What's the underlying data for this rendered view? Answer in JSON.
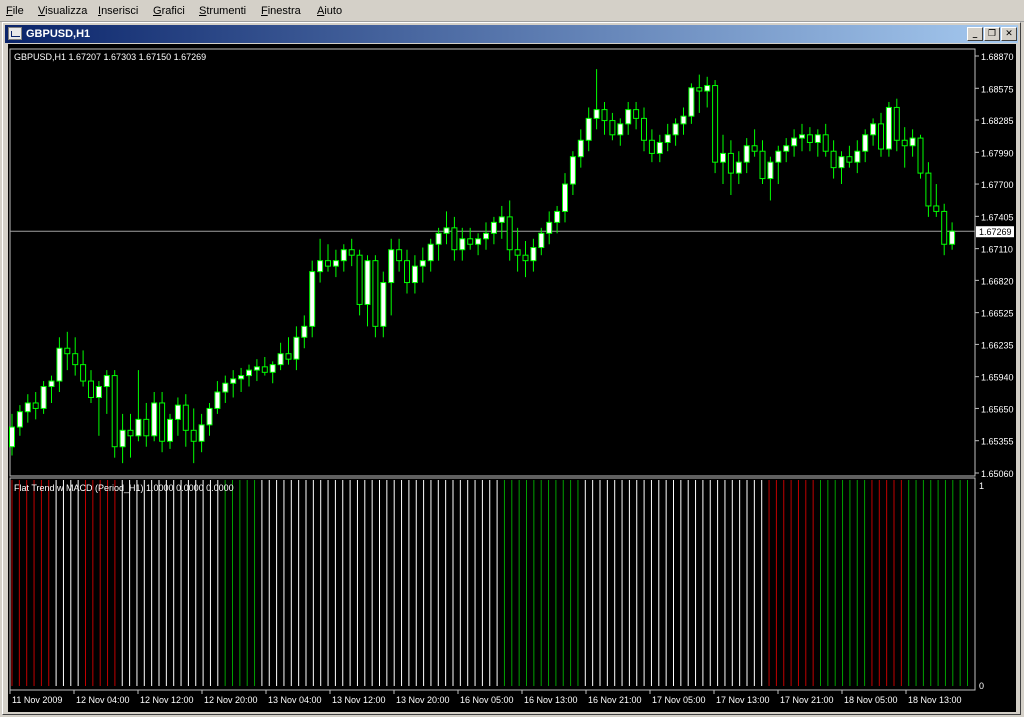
{
  "menu": [
    {
      "label": "File",
      "underline": "F",
      "rest": "ile"
    },
    {
      "label": "Visualizza",
      "underline": "V",
      "rest": "isualizza"
    },
    {
      "label": "Inserisci",
      "underline": "I",
      "rest": "nserisci"
    },
    {
      "label": "Grafici",
      "underline": "G",
      "rest": "rafici"
    },
    {
      "label": "Strumenti",
      "underline": "S",
      "rest": "trumenti"
    },
    {
      "label": "Finestra",
      "underline": "F",
      "rest": "inestra"
    },
    {
      "label": "Aiuto",
      "underline": "A",
      "rest": "iuto"
    }
  ],
  "window": {
    "title": "GBPUSD,H1",
    "buttons": {
      "minimize": "_",
      "restore": "❐",
      "close": "✕"
    }
  },
  "colors": {
    "background": "#000000",
    "bull_fill": "#ffffff",
    "candle_outline": "#00ff00",
    "axis": "#c0c0c0",
    "text": "#ffffff",
    "hist_red": "#c00000",
    "hist_green": "#00a000",
    "hist_white": "#ffffff",
    "current_price_line": "#a0a0a0"
  },
  "chart_data": [
    {
      "type": "candlestick",
      "symbol_info": "GBPUSD,H1  1.67207 1.67303 1.67150 1.67269",
      "current_price": 1.67269,
      "current_price_label": "1.67269",
      "ylim": [
        1.6506,
        1.6887
      ],
      "yticks": [
        "1.68870",
        "1.68575",
        "1.68285",
        "1.67990",
        "1.67700",
        "1.67405",
        "1.67110",
        "1.66820",
        "1.66525",
        "1.66235",
        "1.65940",
        "1.65650",
        "1.65355",
        "1.65060"
      ],
      "ytick_values": [
        1.6887,
        1.68575,
        1.68285,
        1.6799,
        1.677,
        1.67405,
        1.6711,
        1.6682,
        1.66525,
        1.66235,
        1.6594,
        1.6565,
        1.65355,
        1.6506
      ],
      "candles": [
        [
          1.653,
          1.656,
          1.6522,
          1.6548
        ],
        [
          1.6548,
          1.6568,
          1.654,
          1.6562
        ],
        [
          1.6562,
          1.6578,
          1.6552,
          1.657
        ],
        [
          1.657,
          1.658,
          1.6555,
          1.6565
        ],
        [
          1.6565,
          1.659,
          1.656,
          1.6585
        ],
        [
          1.6585,
          1.6595,
          1.657,
          1.659
        ],
        [
          1.659,
          1.663,
          1.658,
          1.662
        ],
        [
          1.662,
          1.6635,
          1.66,
          1.6615
        ],
        [
          1.6615,
          1.663,
          1.6595,
          1.6605
        ],
        [
          1.6605,
          1.6618,
          1.6585,
          1.659
        ],
        [
          1.659,
          1.66,
          1.657,
          1.6575
        ],
        [
          1.6575,
          1.659,
          1.654,
          1.6585
        ],
        [
          1.6585,
          1.66,
          1.656,
          1.6595
        ],
        [
          1.6595,
          1.66,
          1.652,
          1.653
        ],
        [
          1.653,
          1.656,
          1.6515,
          1.6545
        ],
        [
          1.6545,
          1.656,
          1.652,
          1.654
        ],
        [
          1.654,
          1.66,
          1.6535,
          1.6555
        ],
        [
          1.6555,
          1.657,
          1.653,
          1.654
        ],
        [
          1.654,
          1.658,
          1.6535,
          1.657
        ],
        [
          1.657,
          1.658,
          1.6525,
          1.6535
        ],
        [
          1.6535,
          1.656,
          1.6528,
          1.6555
        ],
        [
          1.6555,
          1.6575,
          1.654,
          1.6568
        ],
        [
          1.6568,
          1.6578,
          1.653,
          1.6545
        ],
        [
          1.6545,
          1.6565,
          1.6515,
          1.6535
        ],
        [
          1.6535,
          1.656,
          1.6525,
          1.655
        ],
        [
          1.655,
          1.657,
          1.654,
          1.6565
        ],
        [
          1.6565,
          1.659,
          1.656,
          1.658
        ],
        [
          1.658,
          1.6595,
          1.657,
          1.6588
        ],
        [
          1.6588,
          1.66,
          1.6575,
          1.6592
        ],
        [
          1.6592,
          1.6602,
          1.658,
          1.6595
        ],
        [
          1.6595,
          1.6605,
          1.6585,
          1.66
        ],
        [
          1.66,
          1.661,
          1.659,
          1.6603
        ],
        [
          1.6603,
          1.6612,
          1.6595,
          1.6598
        ],
        [
          1.6598,
          1.6608,
          1.6588,
          1.6605
        ],
        [
          1.6605,
          1.6625,
          1.66,
          1.6615
        ],
        [
          1.6615,
          1.663,
          1.6605,
          1.661
        ],
        [
          1.661,
          1.664,
          1.66,
          1.663
        ],
        [
          1.663,
          1.665,
          1.662,
          1.664
        ],
        [
          1.664,
          1.67,
          1.663,
          1.669
        ],
        [
          1.669,
          1.672,
          1.668,
          1.67
        ],
        [
          1.67,
          1.6715,
          1.669,
          1.6695
        ],
        [
          1.6695,
          1.671,
          1.6685,
          1.67
        ],
        [
          1.67,
          1.6715,
          1.669,
          1.671
        ],
        [
          1.671,
          1.672,
          1.6695,
          1.6705
        ],
        [
          1.6705,
          1.671,
          1.665,
          1.666
        ],
        [
          1.666,
          1.6705,
          1.664,
          1.67
        ],
        [
          1.67,
          1.6705,
          1.663,
          1.664
        ],
        [
          1.664,
          1.669,
          1.663,
          1.668
        ],
        [
          1.668,
          1.672,
          1.665,
          1.671
        ],
        [
          1.671,
          1.672,
          1.669,
          1.67
        ],
        [
          1.67,
          1.671,
          1.667,
          1.668
        ],
        [
          1.668,
          1.6705,
          1.667,
          1.6695
        ],
        [
          1.6695,
          1.6712,
          1.668,
          1.67
        ],
        [
          1.67,
          1.672,
          1.669,
          1.6715
        ],
        [
          1.6715,
          1.673,
          1.67,
          1.6725
        ],
        [
          1.6725,
          1.6745,
          1.6715,
          1.673
        ],
        [
          1.673,
          1.674,
          1.67,
          1.671
        ],
        [
          1.671,
          1.673,
          1.67,
          1.672
        ],
        [
          1.672,
          1.673,
          1.671,
          1.6715
        ],
        [
          1.6715,
          1.6725,
          1.6705,
          1.672
        ],
        [
          1.672,
          1.6735,
          1.671,
          1.6725
        ],
        [
          1.6725,
          1.674,
          1.6715,
          1.6735
        ],
        [
          1.6735,
          1.675,
          1.672,
          1.674
        ],
        [
          1.674,
          1.6755,
          1.67,
          1.671
        ],
        [
          1.671,
          1.673,
          1.669,
          1.6705
        ],
        [
          1.6705,
          1.6718,
          1.6685,
          1.67
        ],
        [
          1.67,
          1.672,
          1.669,
          1.6712
        ],
        [
          1.6712,
          1.673,
          1.6705,
          1.6725
        ],
        [
          1.6725,
          1.6745,
          1.6715,
          1.6735
        ],
        [
          1.6735,
          1.675,
          1.6725,
          1.6745
        ],
        [
          1.6745,
          1.678,
          1.6735,
          1.677
        ],
        [
          1.677,
          1.68,
          1.676,
          1.6795
        ],
        [
          1.6795,
          1.682,
          1.6785,
          1.681
        ],
        [
          1.681,
          1.684,
          1.68,
          1.683
        ],
        [
          1.683,
          1.6875,
          1.682,
          1.6838
        ],
        [
          1.6838,
          1.6845,
          1.6815,
          1.6828
        ],
        [
          1.6828,
          1.6835,
          1.681,
          1.6815
        ],
        [
          1.6815,
          1.683,
          1.6805,
          1.6825
        ],
        [
          1.6825,
          1.6845,
          1.6815,
          1.6838
        ],
        [
          1.6838,
          1.6845,
          1.682,
          1.683
        ],
        [
          1.683,
          1.684,
          1.68,
          1.681
        ],
        [
          1.681,
          1.682,
          1.679,
          1.6798
        ],
        [
          1.6798,
          1.6815,
          1.679,
          1.6808
        ],
        [
          1.6808,
          1.6825,
          1.68,
          1.6815
        ],
        [
          1.6815,
          1.683,
          1.6805,
          1.6825
        ],
        [
          1.6825,
          1.684,
          1.6815,
          1.6832
        ],
        [
          1.6832,
          1.6862,
          1.6825,
          1.6858
        ],
        [
          1.6858,
          1.687,
          1.6835,
          1.6855
        ],
        [
          1.6855,
          1.6868,
          1.684,
          1.686
        ],
        [
          1.686,
          1.6865,
          1.678,
          1.679
        ],
        [
          1.679,
          1.6815,
          1.677,
          1.6798
        ],
        [
          1.6798,
          1.681,
          1.676,
          1.678
        ],
        [
          1.678,
          1.68,
          1.677,
          1.679
        ],
        [
          1.679,
          1.6812,
          1.678,
          1.6805
        ],
        [
          1.6805,
          1.682,
          1.6795,
          1.68
        ],
        [
          1.68,
          1.681,
          1.677,
          1.6775
        ],
        [
          1.6775,
          1.6795,
          1.6755,
          1.679
        ],
        [
          1.679,
          1.6805,
          1.677,
          1.68
        ],
        [
          1.68,
          1.6812,
          1.679,
          1.6805
        ],
        [
          1.6805,
          1.682,
          1.6795,
          1.6812
        ],
        [
          1.6812,
          1.6825,
          1.68,
          1.6815
        ],
        [
          1.6815,
          1.6822,
          1.68,
          1.6808
        ],
        [
          1.6808,
          1.682,
          1.6795,
          1.6815
        ],
        [
          1.6815,
          1.6825,
          1.6795,
          1.68
        ],
        [
          1.68,
          1.681,
          1.6775,
          1.6785
        ],
        [
          1.6785,
          1.68,
          1.677,
          1.6795
        ],
        [
          1.6795,
          1.6805,
          1.6785,
          1.679
        ],
        [
          1.679,
          1.681,
          1.678,
          1.68
        ],
        [
          1.68,
          1.682,
          1.679,
          1.6815
        ],
        [
          1.6815,
          1.683,
          1.6805,
          1.6825
        ],
        [
          1.6825,
          1.6835,
          1.6795,
          1.6802
        ],
        [
          1.6802,
          1.6845,
          1.6795,
          1.684
        ],
        [
          1.684,
          1.6848,
          1.68,
          1.681
        ],
        [
          1.681,
          1.6822,
          1.6785,
          1.6805
        ],
        [
          1.6805,
          1.682,
          1.6795,
          1.6812
        ],
        [
          1.6812,
          1.6815,
          1.6775,
          1.678
        ],
        [
          1.678,
          1.679,
          1.674,
          1.675
        ],
        [
          1.675,
          1.677,
          1.674,
          1.6745
        ],
        [
          1.6745,
          1.6752,
          1.6705,
          1.6715
        ],
        [
          1.6715,
          1.6735,
          1.671,
          1.6727
        ]
      ],
      "xtick_labels": [
        "11 Nov 2009",
        "12 Nov 04:00",
        "12 Nov 12:00",
        "12 Nov 20:00",
        "13 Nov 04:00",
        "13 Nov 12:00",
        "13 Nov 20:00",
        "16 Nov 05:00",
        "16 Nov 13:00",
        "16 Nov 21:00",
        "17 Nov 05:00",
        "17 Nov 13:00",
        "17 Nov 21:00",
        "18 Nov 05:00",
        "18 Nov 13:00"
      ]
    },
    {
      "type": "histogram",
      "title": "Flat Trend w MACD (Period_H1) 1.0000 0.0000 0.0000",
      "ylim": [
        0,
        1
      ],
      "yticks": [
        "1",
        "0"
      ],
      "bars": "rrrrrrwwwwrrrrrwwwwwwwwwwwwwwgggggwwwwwwwwwwwwwwwwwwwwwwwwwwwwwwwwwgggggggggggwwwwwwwwwwwwwwwwwwwwwwwwwrrrrrrrgggggggrrrrrgggggggggrrrrrrr"
    }
  ]
}
